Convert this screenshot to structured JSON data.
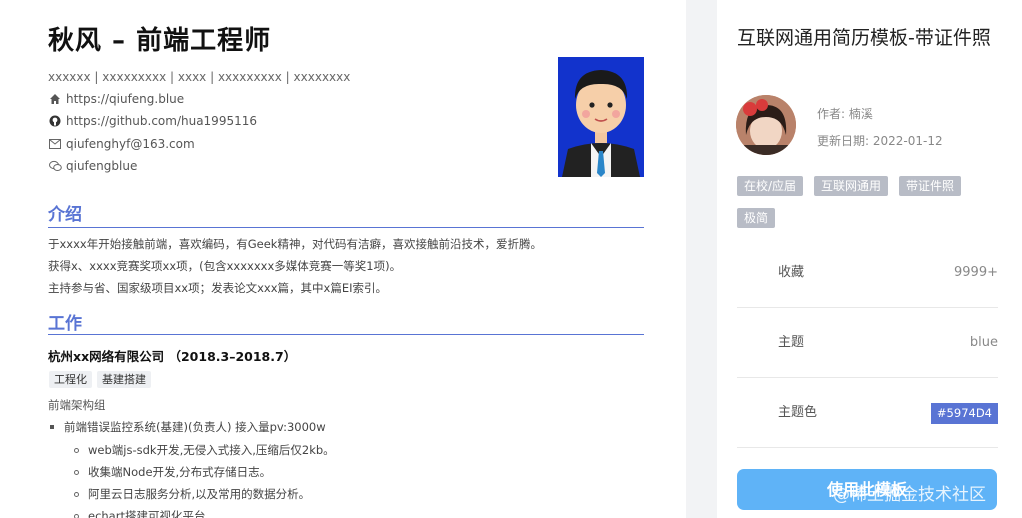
{
  "resume": {
    "name": "秋风 – 前端工程师",
    "info_line": "xxxxxx | xxxxxxxxx | xxxx | xxxxxxxxx | xxxxxxxx",
    "links": [
      {
        "icon": "home-icon",
        "text": "https://qiufeng.blue"
      },
      {
        "icon": "github-icon",
        "text": "https://github.com/hua1995116"
      },
      {
        "icon": "mail-icon",
        "text": "qiufenghyf@163.com"
      },
      {
        "icon": "wechat-icon",
        "text": "qiufengblue"
      }
    ],
    "intro_title": "介绍",
    "intro_lines": [
      "于xxxx年开始接触前端，喜欢编码，有Geek精神，对代码有洁癖，喜欢接触前沿技术，爱折腾。",
      "获得x、xxxx竞赛奖项xx项，(包含xxxxxxx多媒体竞赛一等奖1项)。",
      "主持参与省、国家级项目xx项；发表论文xxx篇，其中x篇EI索引。"
    ],
    "work_title": "工作",
    "company": "杭州xx网络有限公司 （2018.3–2018.7）",
    "tags": [
      "工程化",
      "基建搭建"
    ],
    "team": "前端架构组",
    "bullet": "前端错误监控系统(基建)(负责人) 接入量pv:3000w",
    "sub_bullets": [
      "web端js-sdk开发,无侵入式接入,压缩后仅2kb。",
      "收集端Node开发,分布式存储日志。",
      "阿里云日志服务分析,以及常用的数据分析。",
      "echart搭建可视化平台"
    ]
  },
  "sidebar": {
    "title": "互联网通用简历模板-带证件照",
    "author": "作者: 楠溪",
    "updated": "更新日期: 2022-01-12",
    "tags": [
      "在校/应届",
      "互联网通用",
      "带证件照",
      "极简"
    ],
    "rows": [
      {
        "label": "收藏",
        "value": "9999+"
      },
      {
        "label": "主题",
        "value": "blue"
      },
      {
        "label": "主题色",
        "value": "#5974D4"
      }
    ],
    "use_button": "使用此模板",
    "watermark": "@稀土掘金技术社区"
  }
}
